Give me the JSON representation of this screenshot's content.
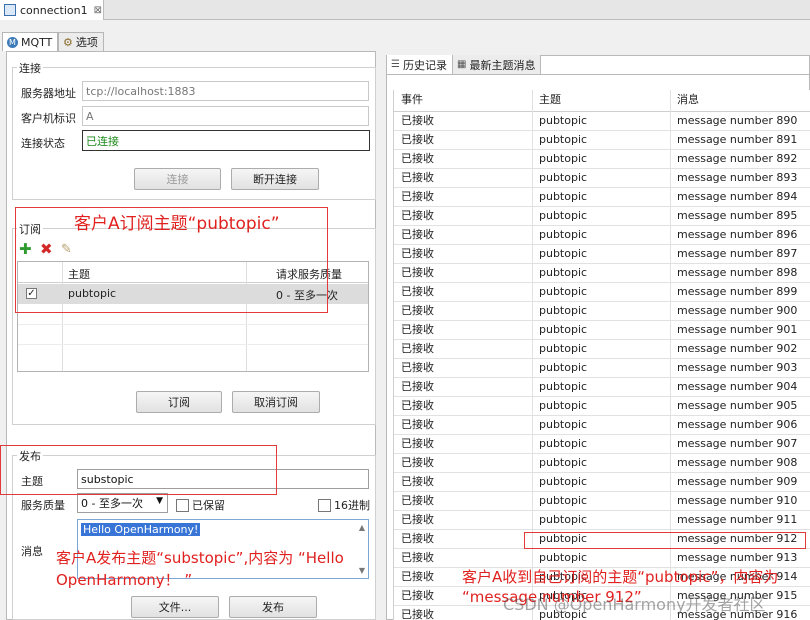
{
  "window": {
    "tab_title": "connection1",
    "tab_close": "⊠"
  },
  "tabs": [
    {
      "label": "MQTT"
    },
    {
      "label": "选项"
    }
  ],
  "connection": {
    "group_label": "连接",
    "server_label": "服务器地址",
    "server_value": "tcp://localhost:1883",
    "client_label": "客户机标识",
    "client_value": "A",
    "status_label": "连接状态",
    "status_value": "已连接",
    "connect_button": "连接",
    "disconnect_button": "断开连接"
  },
  "subscription": {
    "group_label": "订阅",
    "col_topic": "主题",
    "col_qos": "请求服务质量",
    "rows": [
      {
        "checked": true,
        "topic": "pubtopic",
        "qos": "0 - 至多一次"
      }
    ],
    "subscribe_button": "订阅",
    "unsubscribe_button": "取消订阅"
  },
  "publish": {
    "group_label": "发布",
    "topic_label": "主题",
    "topic_value": "substopic",
    "qos_label": "服务质量",
    "qos_value": "0 - 至多一次",
    "retain_label": "已保留",
    "hex_label": "16进制",
    "message_label": "消息",
    "message_value": "Hello OpenHarmony!",
    "file_button": "文件...",
    "publish_button": "发布"
  },
  "history": {
    "tab_history": "历史记录",
    "tab_latest": "最新主题消息",
    "col_event": "事件",
    "col_topic": "主题",
    "col_message": "消息",
    "rows": [
      {
        "event": "已接收",
        "topic": "pubtopic",
        "message": "message number 890"
      },
      {
        "event": "已接收",
        "topic": "pubtopic",
        "message": "message number 891"
      },
      {
        "event": "已接收",
        "topic": "pubtopic",
        "message": "message number 892"
      },
      {
        "event": "已接收",
        "topic": "pubtopic",
        "message": "message number 893"
      },
      {
        "event": "已接收",
        "topic": "pubtopic",
        "message": "message number 894"
      },
      {
        "event": "已接收",
        "topic": "pubtopic",
        "message": "message number 895"
      },
      {
        "event": "已接收",
        "topic": "pubtopic",
        "message": "message number 896"
      },
      {
        "event": "已接收",
        "topic": "pubtopic",
        "message": "message number 897"
      },
      {
        "event": "已接收",
        "topic": "pubtopic",
        "message": "message number 898"
      },
      {
        "event": "已接收",
        "topic": "pubtopic",
        "message": "message number 899"
      },
      {
        "event": "已接收",
        "topic": "pubtopic",
        "message": "message number 900"
      },
      {
        "event": "已接收",
        "topic": "pubtopic",
        "message": "message number 901"
      },
      {
        "event": "已接收",
        "topic": "pubtopic",
        "message": "message number 902"
      },
      {
        "event": "已接收",
        "topic": "pubtopic",
        "message": "message number 903"
      },
      {
        "event": "已接收",
        "topic": "pubtopic",
        "message": "message number 904"
      },
      {
        "event": "已接收",
        "topic": "pubtopic",
        "message": "message number 905"
      },
      {
        "event": "已接收",
        "topic": "pubtopic",
        "message": "message number 906"
      },
      {
        "event": "已接收",
        "topic": "pubtopic",
        "message": "message number 907"
      },
      {
        "event": "已接收",
        "topic": "pubtopic",
        "message": "message number 908"
      },
      {
        "event": "已接收",
        "topic": "pubtopic",
        "message": "message number 909"
      },
      {
        "event": "已接收",
        "topic": "pubtopic",
        "message": "message number 910"
      },
      {
        "event": "已接收",
        "topic": "pubtopic",
        "message": "message number 911"
      },
      {
        "event": "已接收",
        "topic": "pubtopic",
        "message": "message number 912"
      },
      {
        "event": "已接收",
        "topic": "pubtopic",
        "message": "message number 913"
      },
      {
        "event": "已接收",
        "topic": "pubtopic",
        "message": "message number 914"
      },
      {
        "event": "已接收",
        "topic": "pubtopic",
        "message": "message number 915"
      },
      {
        "event": "已接收",
        "topic": "pubtopic",
        "message": "message number 916"
      }
    ]
  },
  "annotations": {
    "subscribe_note": "客户A订阅主题“pubtopic”",
    "publish_note_1": "客户A发布主题“substopic”,内容为 “Hello",
    "publish_note_2": "OpenHarmony！ ”",
    "receive_note_1": "客户A收到自己订阅的主题“pubtopic”，内容为",
    "receive_note_2": "“message number 912”"
  },
  "watermark": "CSDN @OpenHarmony开发者社区",
  "colors": {
    "annotation_red": "#e0211f",
    "status_green": "#1a8a1a"
  }
}
